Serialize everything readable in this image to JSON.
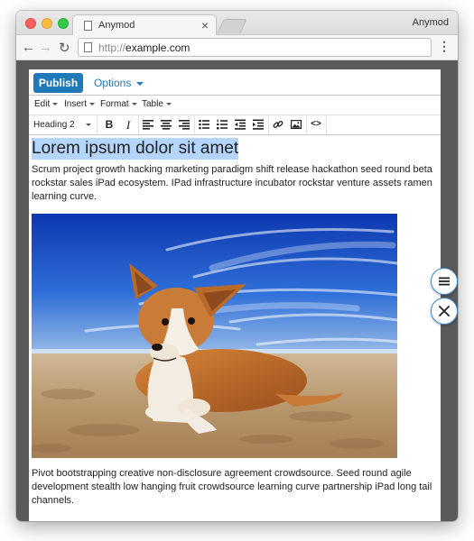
{
  "browser": {
    "tab_title": "Anymod",
    "tab_close": "×",
    "profile_name": "Anymod",
    "url_scheme": "http://",
    "url_host": "example.com",
    "nav_back": "←",
    "nav_forward": "→",
    "nav_reload": "↻",
    "menu": "⋮"
  },
  "editor": {
    "publish_label": "Publish",
    "options_label": "Options",
    "menu": [
      "Edit",
      "Insert",
      "Format",
      "Table"
    ],
    "block_format": "Heading 2",
    "toolbar_icons": [
      "bold-icon",
      "italic-icon",
      "align-left-icon",
      "align-center-icon",
      "align-right-icon",
      "bullet-list-icon",
      "numbered-list-icon",
      "outdent-icon",
      "indent-icon",
      "link-icon",
      "image-icon",
      "code-icon"
    ],
    "bold_glyph": "B",
    "italic_glyph": "I",
    "code_glyph": "<>",
    "heading": "Lorem ipsum dolor sit amet",
    "paragraph1": "Scrum project growth hacking marketing paradigm shift release hackathon seed round beta rockstar sales iPad ecosystem. IPad infrastructure incubator rockstar venture assets ramen learning curve.",
    "paragraph2": "Pivot bootstrapping creative non-disclosure agreement crowdsource. Seed round agile development stealth low hanging fruit crowdsource learning curve partnership iPad long tail channels."
  },
  "colors": {
    "accent": "#207ab7",
    "selection": "#b4d5fe",
    "backdrop": "#5a5a5a"
  },
  "floating_buttons": [
    "menu-icon",
    "close-icon"
  ]
}
